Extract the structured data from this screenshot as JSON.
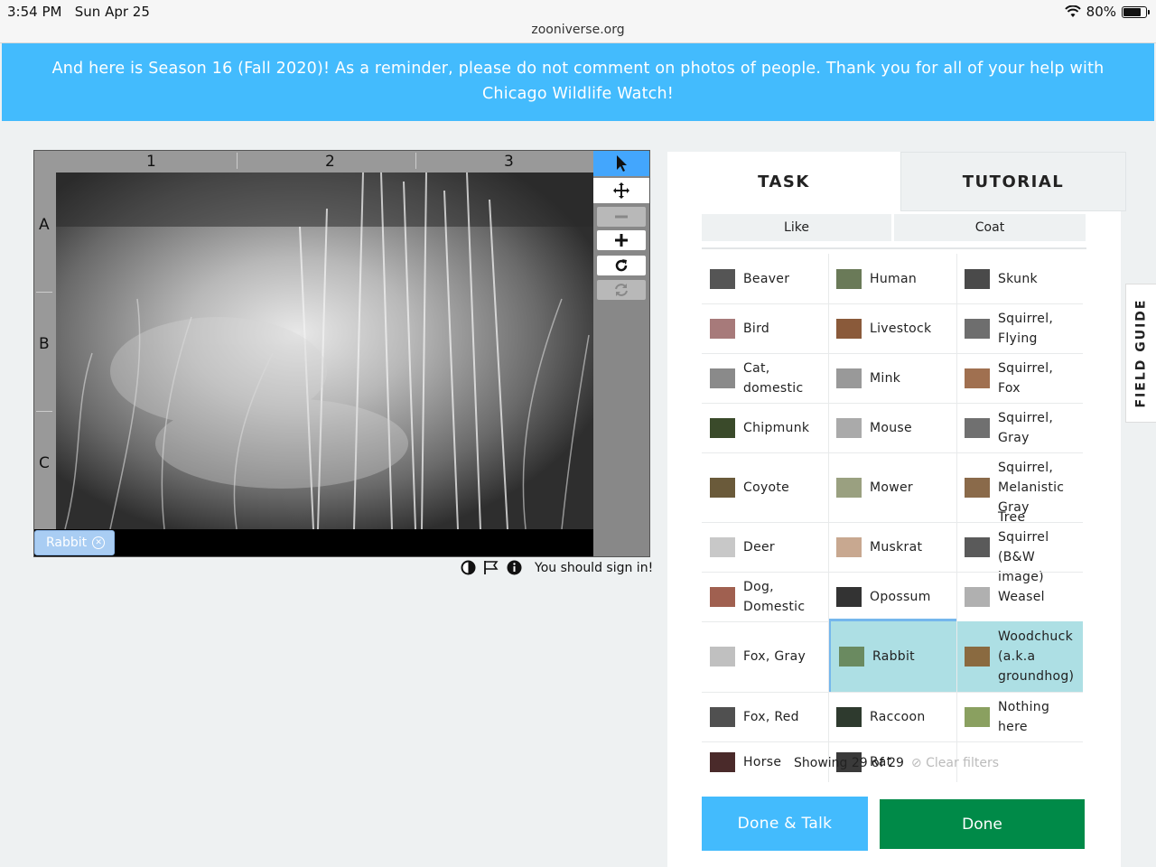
{
  "status_bar": {
    "time": "3:54 PM",
    "date": "Sun Apr 25",
    "battery": "80%",
    "battery_level": 0.8,
    "url": "zooniverse.org"
  },
  "banner": {
    "text": "And here is Season 16 (Fall 2020)! As a reminder, please do not comment on photos of people. Thank you for all of your help with Chicago Wildlife Watch!"
  },
  "viewer": {
    "col_labels": [
      "1",
      "2",
      "3"
    ],
    "row_labels": [
      "A",
      "B",
      "C"
    ],
    "subject_tag": "Rabbit",
    "sign_in": "You should sign in!"
  },
  "panel": {
    "tabs": {
      "task": "TASK",
      "tutorial": "TUTORIAL"
    },
    "filters": {
      "like": "Like",
      "coat": "Coat"
    },
    "choices": [
      [
        "Beaver",
        "Human",
        "Skunk"
      ],
      [
        "Bird",
        "Livestock",
        "Squirrel, Flying"
      ],
      [
        "Cat, domestic",
        "Mink",
        "Squirrel, Fox"
      ],
      [
        "Chipmunk",
        "Mouse",
        "Squirrel, Gray"
      ],
      [
        "Coyote",
        "Mower",
        "Squirrel, Melanistic Gray"
      ],
      [
        "Deer",
        "Muskrat",
        "Tree Squirrel (B&W image)"
      ],
      [
        "Dog, Domestic",
        "Opossum",
        "Weasel"
      ],
      [
        "Fox, Gray",
        "Rabbit",
        "Woodchuck (a.k.a groundhog)"
      ],
      [
        "Fox, Red",
        "Raccoon",
        "Nothing here"
      ],
      [
        "Horse",
        "Rat"
      ]
    ],
    "selected": [
      "Rabbit",
      "Woodchuck (a.k.a groundhog)"
    ],
    "showing_label": "Showing 29 of 29",
    "clear_filters": "Clear filters",
    "done_talk": "Done & Talk",
    "done": "Done"
  },
  "field_guide": "FIELD GUIDE",
  "thumb_colors": {
    "Beaver": "#555555",
    "Human": "#6a7a58",
    "Skunk": "#4a4a4a",
    "Bird": "#a77a7a",
    "Livestock": "#8a5a3a",
    "Squirrel, Flying": "#6e6e6e",
    "Cat, domestic": "#8a8a8a",
    "Mink": "#999999",
    "Squirrel, Fox": "#a07050",
    "Chipmunk": "#3a4a2a",
    "Mouse": "#aaaaaa",
    "Squirrel, Gray": "#707070",
    "Coyote": "#6a5a3a",
    "Mower": "#9aa080",
    "Squirrel, Melanistic Gray": "#8a6a4a",
    "Deer": "#c8c8c8",
    "Muskrat": "#c8a890",
    "Tree Squirrel (B&W image)": "#5a5a5a",
    "Dog, Domestic": "#a06050",
    "Opossum": "#333333",
    "Weasel": "#b0b0b0",
    "Fox, Gray": "#c0c0c0",
    "Rabbit": "#6a8a60",
    "Woodchuck (a.k.a groundhog)": "#8a6a40",
    "Fox, Red": "#505050",
    "Raccoon": "#2e3a2e",
    "Nothing here": "#8aa060",
    "Horse": "#4a2a2a",
    "Rat": "#3a3a3a"
  }
}
